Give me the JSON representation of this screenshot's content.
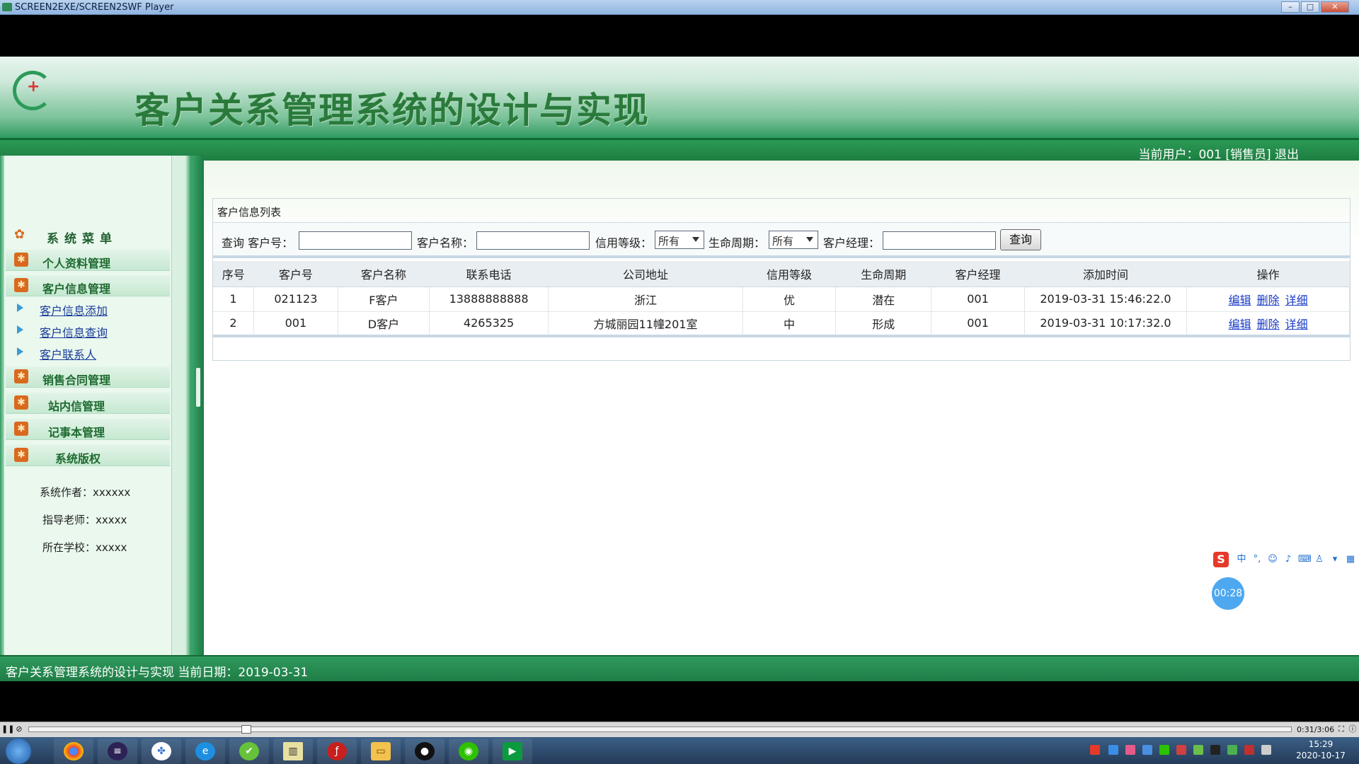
{
  "window": {
    "title": "SCREEN2EXE/SCREEN2SWF Player",
    "minimize": "–",
    "maximize": "□",
    "close": "✕"
  },
  "banner": {
    "title": "客户关系管理系统的设计与实现"
  },
  "userbar": {
    "text": "当前用户：001 [销售员] ",
    "logout": "退出"
  },
  "sidebar": {
    "header": "系统菜单",
    "items": [
      {
        "label": "个人资料管理"
      },
      {
        "label": "客户信息管理"
      },
      {
        "label": "销售合同管理"
      },
      {
        "label": "站内信管理"
      },
      {
        "label": "记事本管理"
      },
      {
        "label": "系统版权"
      }
    ],
    "subitems": [
      {
        "label": "客户信息添加"
      },
      {
        "label": "客户信息查询"
      },
      {
        "label": "客户联系人"
      }
    ],
    "info": [
      "系统作者：xxxxxx",
      "指导老师：xxxxx",
      "所在学校：xxxxx"
    ]
  },
  "panel": {
    "title": "客户信息列表"
  },
  "search": {
    "prefix": "查询 客户号：",
    "name_label": "客户名称：",
    "credit_label": "信用等级：",
    "credit_value": "所有",
    "life_label": "生命周期：",
    "life_value": "所有",
    "manager_label": "客户经理：",
    "button": "查询"
  },
  "table": {
    "headers": [
      "序号",
      "客户号",
      "客户名称",
      "联系电话",
      "公司地址",
      "信用等级",
      "生命周期",
      "客户经理",
      "添加时间",
      "操作"
    ],
    "rows": [
      {
        "seq": "1",
        "id": "021123",
        "name": "F客户",
        "phone": "13888888888",
        "address": "浙江",
        "credit": "优",
        "life": "潜在",
        "manager": "001",
        "time": "2019-03-31 15:46:22.0"
      },
      {
        "seq": "2",
        "id": "001",
        "name": "D客户",
        "phone": "4265325",
        "address": "方城丽园11幢201室",
        "credit": "中",
        "life": "形成",
        "manager": "001",
        "time": "2019-03-31 10:17:32.0"
      }
    ],
    "actions": {
      "edit": "编辑",
      "delete": "删除",
      "detail": "详细"
    }
  },
  "statusbar": {
    "text": "客户关系管理系统的设计与实现 当前日期：2019-03-31"
  },
  "overlay": {
    "ime_logo": "S",
    "ime_lang": "中",
    "timer": "00:28"
  },
  "player": {
    "time": "0:31/3:06"
  },
  "taskbar": {
    "clock_time": "15:29",
    "clock_date": "2020-10-17"
  },
  "colors": {
    "brand_green": "#2f9a5e",
    "title_green": "#2a7a3c",
    "link_blue": "#1a3cc8"
  }
}
